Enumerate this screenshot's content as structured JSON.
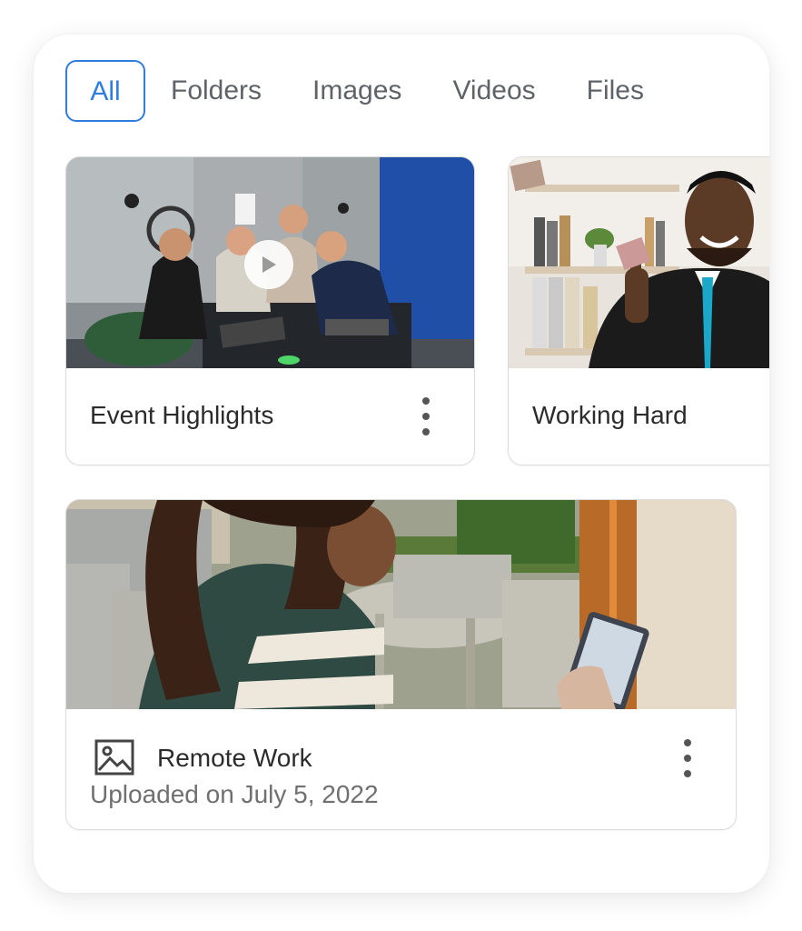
{
  "tabs": [
    {
      "label": "All",
      "active": true
    },
    {
      "label": "Folders",
      "active": false
    },
    {
      "label": "Images",
      "active": false
    },
    {
      "label": "Videos",
      "active": false
    },
    {
      "label": "Files",
      "active": false
    }
  ],
  "cards": {
    "event": {
      "title": "Event Highlights",
      "type": "video"
    },
    "working": {
      "title": "Working Hard",
      "type": "image"
    },
    "remote": {
      "title": "Remote Work",
      "subtitle": "Uploaded on July 5, 2022",
      "type": "image"
    }
  },
  "colors": {
    "accent": "#2f7de1",
    "text": "#2b2b2b",
    "muted": "#707070",
    "border": "#dcdcdc"
  },
  "icons": {
    "play": "play-icon",
    "menu": "more-vertical-icon",
    "image": "image-icon"
  }
}
